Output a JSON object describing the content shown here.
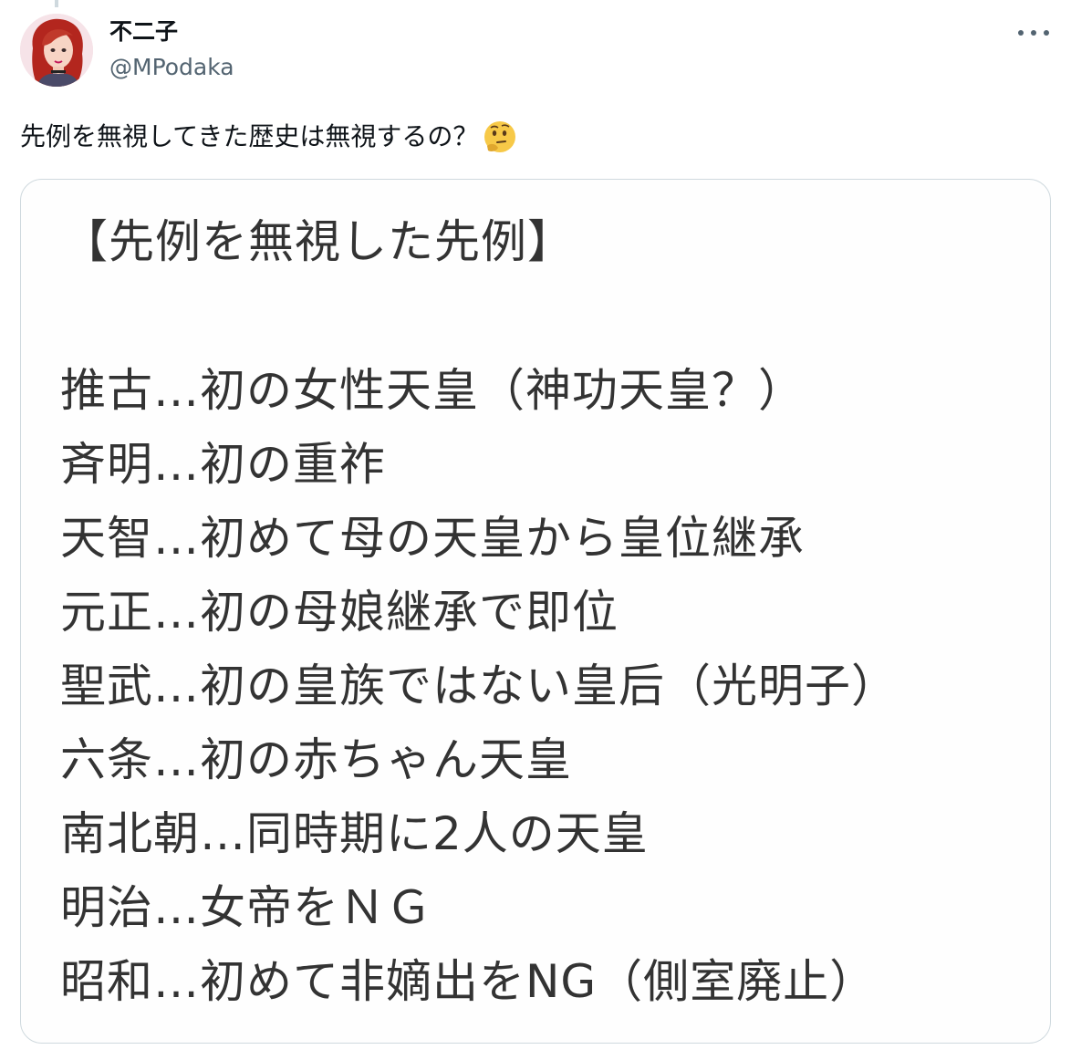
{
  "tweet": {
    "author": {
      "display_name": "不二子",
      "handle": "@MPodaka",
      "avatar_icon": "avatar-illustration"
    },
    "more_icon": "more-horizontal-icon",
    "text": "先例を無視してきた歴史は無視するの？",
    "emoji": "thinking-face-emoji"
  },
  "media": {
    "title": "【先例を無視した先例】",
    "lines": [
      "推古…初の女性天皇（神功天皇？）",
      "斉明…初の重祚",
      "天智…初めて母の天皇から皇位継承",
      "元正…初の母娘継承で即位",
      "聖武…初の皇族ではない皇后（光明子）",
      "六条…初の赤ちゃん天皇",
      "南北朝…同時期に2人の天皇",
      "明治…女帝をＮＧ",
      "昭和…初めて非嫡出をNG（側室廃止）"
    ]
  },
  "colors": {
    "primary_text": "#0f1419",
    "secondary_text": "#536471",
    "border": "#cfd9de",
    "image_text": "#333333"
  }
}
